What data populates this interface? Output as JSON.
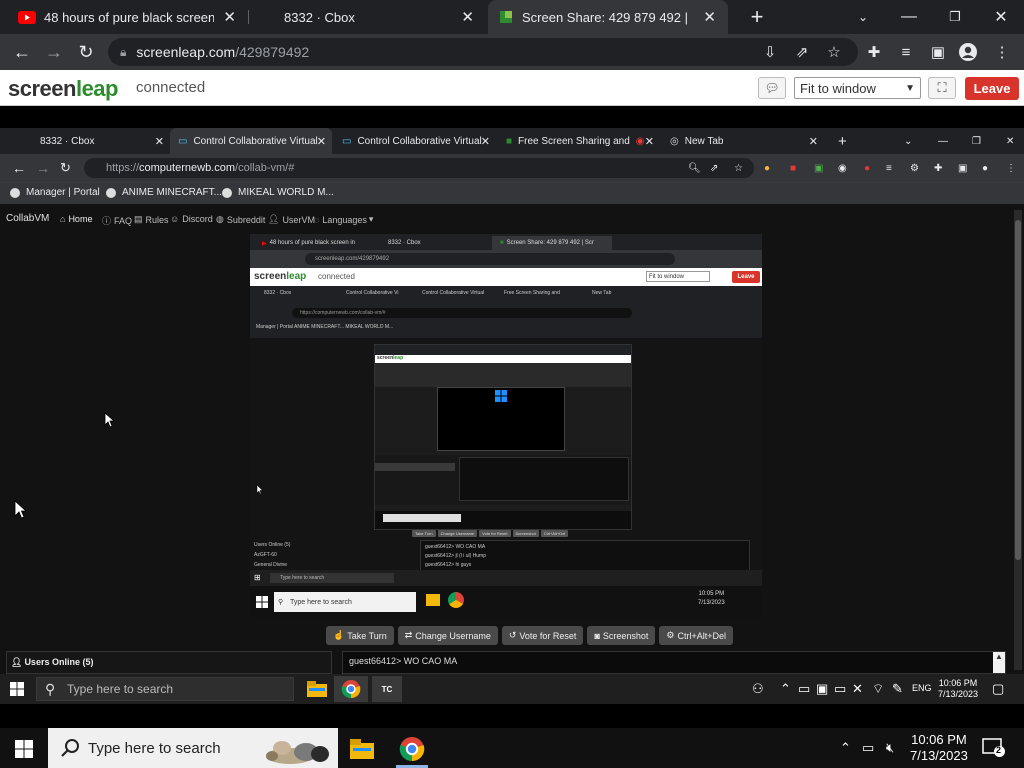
{
  "browser": {
    "tabs": [
      {
        "title": "48 hours of pure black screen in |",
        "icon": "youtube-icon"
      },
      {
        "title": "8332 · Cbox",
        "icon": "none"
      },
      {
        "title": "Screen Share: 429 879 492 | Scre",
        "icon": "screenleap-icon"
      }
    ],
    "url_host": "screenleap.com",
    "url_path": "/429879492"
  },
  "screenleap": {
    "logo_prefix": "screen",
    "logo_suffix": "leap",
    "status": "connected",
    "fit_option": "Fit to window",
    "leave_label": "Leave"
  },
  "remote": {
    "tabs": [
      {
        "title": "8332 · Cbox"
      },
      {
        "title": "Control Collaborative Virtual"
      },
      {
        "title": "Control Collaborative Virtual"
      },
      {
        "title": "Free Screen Sharing and"
      },
      {
        "title": "New Tab"
      }
    ],
    "url_prefix": "https://",
    "url_host": "computernewb.com",
    "url_path": "/collab-vm/#",
    "bookmarks": [
      "Manager | Portal",
      "ANIME MINECRAFT...",
      "MIKEAL WORLD M..."
    ],
    "collabvm": {
      "brand": "CollabVM",
      "nav": [
        "Home",
        "FAQ",
        "Rules",
        "Discord",
        "Subreddit",
        "UserVM",
        "Languages"
      ],
      "buttons": [
        "Take Turn",
        "Change Username",
        "Vote for Reset",
        "Screenshot",
        "Ctrl+Alt+Del"
      ],
      "users_online": "Users Online (5)",
      "chat_line": "guest66412> WO CAO MA"
    },
    "vm": {
      "tabs": [
        "48 hours of pure black screen in",
        "8332 · Cbox",
        "Screen Share: 429 879 492 | Scr"
      ],
      "url": "screenleap.com/429879492",
      "sl_connected": "connected",
      "sl_fit": "Fit to window",
      "sl_leave": "Leave",
      "inner_tabs": [
        "8332 · Cbox",
        "Control Collaborative Vi",
        "Control Collaborative Virtual",
        "Free Screen Sharing and",
        "New Tab"
      ],
      "inner_url": "https://computernewb.com/collab-vm/#",
      "inner_bookmarks": "Manager | Portal   ANIME MINECRAFT...   MIKEAL WORLD M...",
      "users": [
        "Users Online (5)",
        "AzGFT-60",
        "General Divine"
      ],
      "chat": [
        "guest66412> WO CAO MA",
        "guest66412> jl (l i ul) Hump",
        "guest66412> hi guys"
      ],
      "search": "Type here to search",
      "time": "10:05 PM",
      "date": "7/13/2023"
    },
    "taskbar": {
      "search_placeholder": "Type here to search",
      "lang": "ENG",
      "time": "10:06 PM",
      "date": "7/13/2023"
    }
  },
  "taskbar": {
    "search_placeholder": "Type here to search",
    "time": "10:06 PM",
    "date": "7/13/2023",
    "notifications": "2"
  },
  "colors": {
    "chrome_dark": "#202124",
    "chrome_toolbar": "#35363a",
    "screenleap_green": "#2e8b2e",
    "leave_red": "#d9342b"
  }
}
